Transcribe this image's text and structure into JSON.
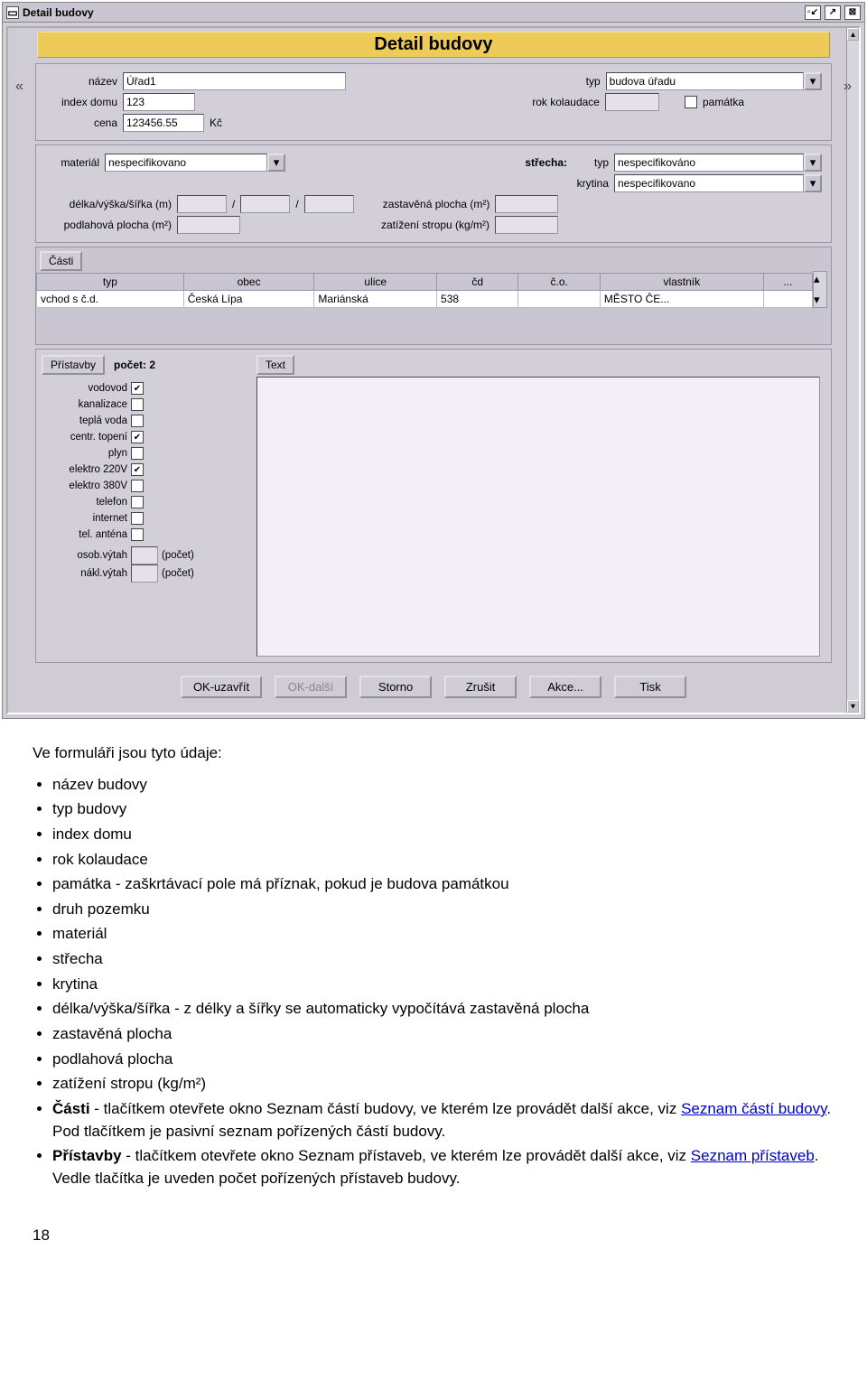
{
  "window": {
    "title": "Detail budovy",
    "ribbon": "Detail budovy"
  },
  "form": {
    "labels": {
      "nazev": "název",
      "typ": "typ",
      "index_domu": "index domu",
      "rok_kolaudace": "rok kolaudace",
      "pamatka": "památka",
      "cena": "cena",
      "kc": "Kč",
      "material": "materiál",
      "strecha": "střecha:",
      "strecha_typ": "typ",
      "krytina": "krytina",
      "dvs": "délka/výška/šířka (m)",
      "slash": "/",
      "zast_plocha": "zastavěná plocha (m²)",
      "podl_plocha": "podlahová plocha (m²)",
      "zatizeni": "zatížení stropu (kg/m²)"
    },
    "values": {
      "nazev": "Úřad1",
      "typ": "budova úřadu",
      "index_domu": "123",
      "rok_kolaudace": "",
      "cena": "123456.55",
      "material": "nespecifikovano",
      "strecha_typ": "nespecifikováno",
      "krytina": "nespecifikovano",
      "delka": "",
      "vyska": "",
      "sirka": "",
      "zast_plocha": "",
      "podl_plocha": "",
      "zatizeni": ""
    }
  },
  "casti": {
    "tab": "Části",
    "headers": [
      "typ",
      "obec",
      "ulice",
      "čd",
      "č.o.",
      "vlastník",
      "..."
    ],
    "row": [
      "vchod s č.d.",
      "Česká Lípa",
      "Mariánská",
      "538",
      "",
      "MĚSTO ČE...",
      ""
    ]
  },
  "pristavby": {
    "btn": "Přístavby",
    "count_label": "počet: 2",
    "text_btn": "Text"
  },
  "utilities": [
    {
      "label": "vodovod",
      "checked": true
    },
    {
      "label": "kanalizace",
      "checked": false
    },
    {
      "label": "teplá voda",
      "checked": false
    },
    {
      "label": "centr. topení",
      "checked": true
    },
    {
      "label": "plyn",
      "checked": false
    },
    {
      "label": "elektro 220V",
      "checked": true
    },
    {
      "label": "elektro 380V",
      "checked": false
    },
    {
      "label": "telefon",
      "checked": false
    },
    {
      "label": "internet",
      "checked": false
    },
    {
      "label": "tel. anténa",
      "checked": false
    }
  ],
  "lifts": {
    "osob_label": "osob.výtah",
    "nakl_label": "nákl.výtah",
    "pocet": "(počet)"
  },
  "buttons": {
    "ok_close": "OK-uzavřít",
    "ok_next": "OK-další",
    "storno": "Storno",
    "zrusit": "Zrušit",
    "akce": "Akce...",
    "tisk": "Tisk"
  },
  "doc": {
    "intro": "Ve formuláři jsou tyto údaje:",
    "items": {
      "nazev": "název budovy",
      "typ": "typ budovy",
      "index": "index domu",
      "rok": "rok kolaudace",
      "pamatka": "památka - zaškrtávací pole má příznak, pokud je budova památkou",
      "druh": "druh pozemku",
      "material": "materiál",
      "strecha": "střecha",
      "krytina": "krytina",
      "dvs": "délka/výška/šířka - z délky a šířky se automaticky vypočítává zastavěná plocha",
      "zast": "zastavěná plocha",
      "podl": "podlahová plocha",
      "zat": "zatížení stropu (kg/m²)",
      "casti_pre": "Části",
      "casti_rest": " - tlačítkem otevřete okno Seznam částí budovy, ve kterém lze provádět další akce, viz ",
      "casti_link": "Seznam částí budovy",
      "casti_tail": ". Pod tlačítkem je pasivní seznam pořízených částí budovy.",
      "prist_pre": "Přístavby",
      "prist_rest": " - tlačítkem otevřete okno Seznam přístaveb, ve kterém lze provádět další akce, viz ",
      "prist_link": "Seznam přístaveb",
      "prist_tail": ". Vedle tlačítka je uveden počet pořízených přístaveb budovy."
    },
    "page": "18"
  }
}
